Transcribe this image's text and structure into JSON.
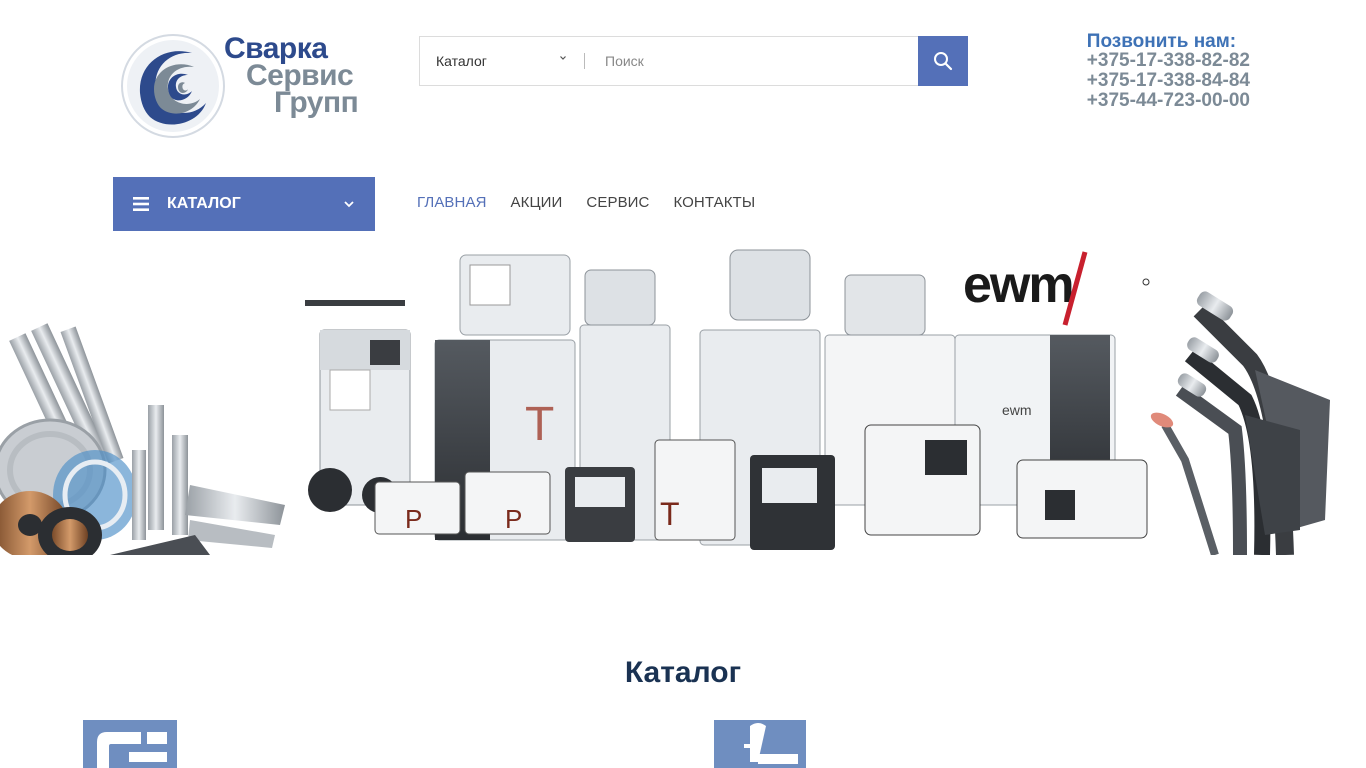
{
  "logo": {
    "line1": "Сварка",
    "line2": "Сервис",
    "line3": "Групп",
    "brand_color": "#2d4a8c",
    "secondary_color": "#7c8a96"
  },
  "search": {
    "category": "Каталог",
    "placeholder": "Поиск",
    "icon": "search-icon"
  },
  "contacts": {
    "call_label": "Позвонить нам:",
    "phones": [
      "+375-17-338-82-82",
      "+375-17-338-84-84",
      "+375-44-723-00-00"
    ]
  },
  "nav": {
    "catalog_label": "КАТАЛОГ",
    "items": [
      {
        "label": "ГЛАВНАЯ",
        "active": true
      },
      {
        "label": "АКЦИИ",
        "active": false
      },
      {
        "label": "СЕРВИС",
        "active": false
      },
      {
        "label": "КОНТАКТЫ",
        "active": false
      }
    ]
  },
  "banner": {
    "brand_logo": "ewm"
  },
  "catalog_section": {
    "title": "Каталог"
  },
  "colors": {
    "accent": "#5470b8",
    "title": "#1a3252",
    "phone_label": "#3e72b6"
  }
}
